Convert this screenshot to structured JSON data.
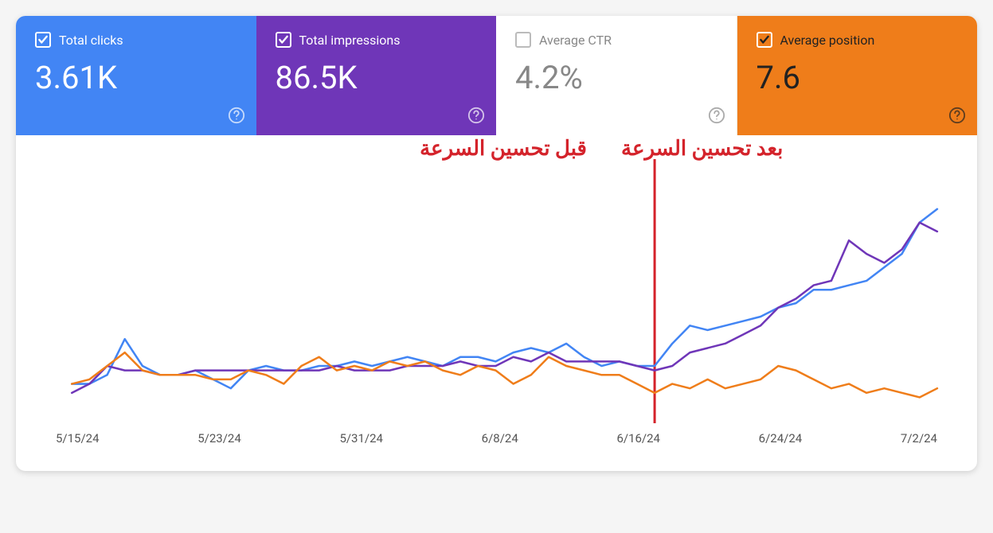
{
  "metrics": {
    "clicks": {
      "label": "Total clicks",
      "value": "3.61K",
      "checked": true
    },
    "impressions": {
      "label": "Total impressions",
      "value": "86.5K",
      "checked": true
    },
    "ctr": {
      "label": "Average CTR",
      "value": "4.2%",
      "checked": false
    },
    "position": {
      "label": "Average position",
      "value": "7.6",
      "checked": true
    }
  },
  "annotations": {
    "before": "قبل تحسين السرعة",
    "after": "بعد تحسين السرعة"
  },
  "colors": {
    "clicks": "#4285f4",
    "impressions": "#6f36b8",
    "ctr_inactive": "#888888",
    "position": "#ef7d1a",
    "divider": "#d4232b"
  },
  "chart_data": {
    "type": "line",
    "xlabel": "",
    "ylabel": "",
    "x_ticks": [
      "5/15/24",
      "5/23/24",
      "5/31/24",
      "6/8/24",
      "6/16/24",
      "6/24/24",
      "7/2/24"
    ],
    "divider_x_index": 33,
    "categories_index": [
      0,
      1,
      2,
      3,
      4,
      5,
      6,
      7,
      8,
      9,
      10,
      11,
      12,
      13,
      14,
      15,
      16,
      17,
      18,
      19,
      20,
      21,
      22,
      23,
      24,
      25,
      26,
      27,
      28,
      29,
      30,
      31,
      32,
      33,
      34,
      35,
      36,
      37,
      38,
      39,
      40,
      41,
      42,
      43,
      44,
      45,
      46,
      47,
      48,
      49
    ],
    "series": [
      {
        "name": "Total clicks",
        "color": "#4285f4",
        "values_rel": [
          14,
          14,
          18,
          34,
          22,
          18,
          18,
          20,
          16,
          12,
          20,
          22,
          20,
          20,
          22,
          22,
          24,
          22,
          24,
          26,
          24,
          22,
          26,
          26,
          24,
          28,
          30,
          28,
          32,
          26,
          22,
          24,
          22,
          22,
          32,
          40,
          38,
          40,
          42,
          44,
          48,
          50,
          56,
          56,
          58,
          60,
          66,
          72,
          86,
          92
        ]
      },
      {
        "name": "Total impressions",
        "color": "#6f36b8",
        "values_rel": [
          10,
          14,
          22,
          20,
          20,
          18,
          18,
          20,
          20,
          20,
          20,
          20,
          20,
          20,
          20,
          22,
          20,
          20,
          20,
          22,
          22,
          22,
          24,
          22,
          22,
          26,
          24,
          28,
          24,
          24,
          24,
          24,
          22,
          20,
          22,
          28,
          30,
          32,
          36,
          40,
          48,
          52,
          58,
          60,
          78,
          72,
          68,
          74,
          86,
          82
        ]
      },
      {
        "name": "Average position",
        "color": "#ef7d1a",
        "values_rel": [
          14,
          16,
          22,
          28,
          20,
          18,
          18,
          18,
          16,
          16,
          20,
          18,
          14,
          22,
          26,
          20,
          22,
          20,
          24,
          22,
          24,
          20,
          18,
          22,
          20,
          14,
          18,
          26,
          22,
          20,
          18,
          18,
          14,
          10,
          14,
          12,
          16,
          12,
          14,
          16,
          22,
          20,
          16,
          12,
          14,
          10,
          12,
          10,
          8,
          12
        ]
      }
    ],
    "notes": "values_rel are relative heights 0–100 read off the unlabeled y-axis; Average position series is inverted (lower number = better rank, plotted as such)."
  }
}
